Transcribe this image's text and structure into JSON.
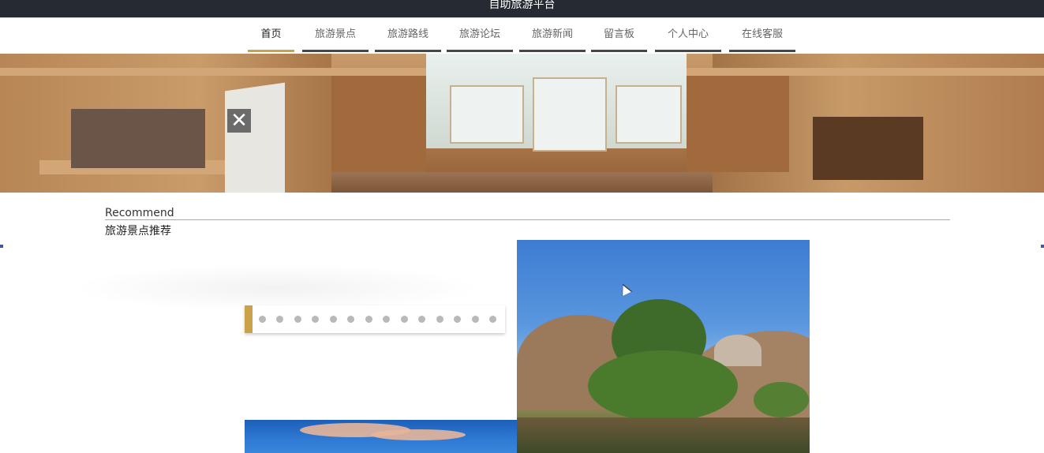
{
  "header": {
    "title": "自助旅游平台"
  },
  "nav": {
    "items": [
      {
        "label": "首页"
      },
      {
        "label": "旅游景点"
      },
      {
        "label": "旅游路线"
      },
      {
        "label": "旅游论坛"
      },
      {
        "label": "旅游新闻"
      },
      {
        "label": "留言板"
      },
      {
        "label": "个人中心"
      },
      {
        "label": "在线客服"
      }
    ],
    "active_index": 0
  },
  "banner": {
    "icon": "close-icon-sign",
    "sign_glyph": "✕"
  },
  "recommend": {
    "title_en": "Recommend",
    "title_cn": "旅游景点推荐"
  },
  "carousel": {
    "dot_count": 14,
    "active_color": "#c9a24a",
    "dot_color": "#b9b9b9"
  },
  "colors": {
    "topbar": "#262b33",
    "accent": "#c9a24a",
    "nav_underline": "#474747"
  }
}
